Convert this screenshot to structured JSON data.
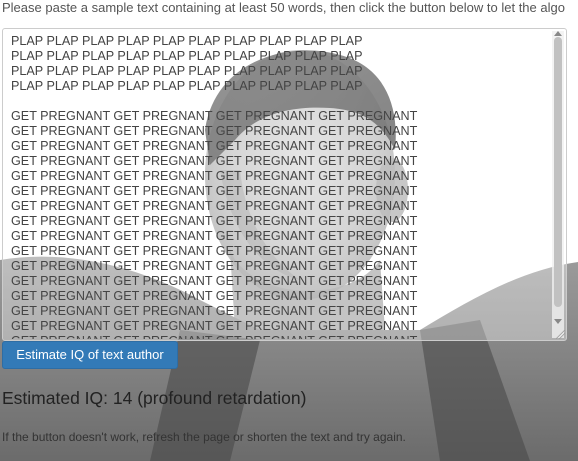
{
  "instructions": "Please paste a sample text containing at least 50 words, then click the button below to let the algo",
  "textarea": {
    "value": "PLAP PLAP PLAP PLAP PLAP PLAP PLAP PLAP PLAP PLAP\nPLAP PLAP PLAP PLAP PLAP PLAP PLAP PLAP PLAP PLAP\nPLAP PLAP PLAP PLAP PLAP PLAP PLAP PLAP PLAP PLAP\nPLAP PLAP PLAP PLAP PLAP PLAP PLAP PLAP PLAP PLAP\n\nGET PREGNANT GET PREGNANT GET PREGNANT GET PREGNANT\nGET PREGNANT GET PREGNANT GET PREGNANT GET PREGNANT\nGET PREGNANT GET PREGNANT GET PREGNANT GET PREGNANT\nGET PREGNANT GET PREGNANT GET PREGNANT GET PREGNANT\nGET PREGNANT GET PREGNANT GET PREGNANT GET PREGNANT\nGET PREGNANT GET PREGNANT GET PREGNANT GET PREGNANT\nGET PREGNANT GET PREGNANT GET PREGNANT GET PREGNANT\nGET PREGNANT GET PREGNANT GET PREGNANT GET PREGNANT\nGET PREGNANT GET PREGNANT GET PREGNANT GET PREGNANT\nGET PREGNANT GET PREGNANT GET PREGNANT GET PREGNANT\nGET PREGNANT GET PREGNANT GET PREGNANT GET PREGNANT\nGET PREGNANT GET PREGNANT GET PREGNANT GET PREGNANT\nGET PREGNANT GET PREGNANT GET PREGNANT GET PREGNANT\nGET PREGNANT GET PREGNANT GET PREGNANT GET PREGNANT\nGET PREGNANT GET PREGNANT GET PREGNANT GET PREGNANT\nGET PREGNANT GET PREGNANT GET PREGNANT GET PREGNANT\nGET PREGNANT GET PREGNANT GET PREGNANT GET PREGNANT"
  },
  "button_label": "Estimate IQ of text author",
  "result_text": "Estimated IQ: 14 (profound retardation)",
  "hint_text": "If the button doesn't work, refresh the page or shorten the text and try again.",
  "colors": {
    "button_bg": "#337ab7",
    "button_text": "#ffffff"
  }
}
